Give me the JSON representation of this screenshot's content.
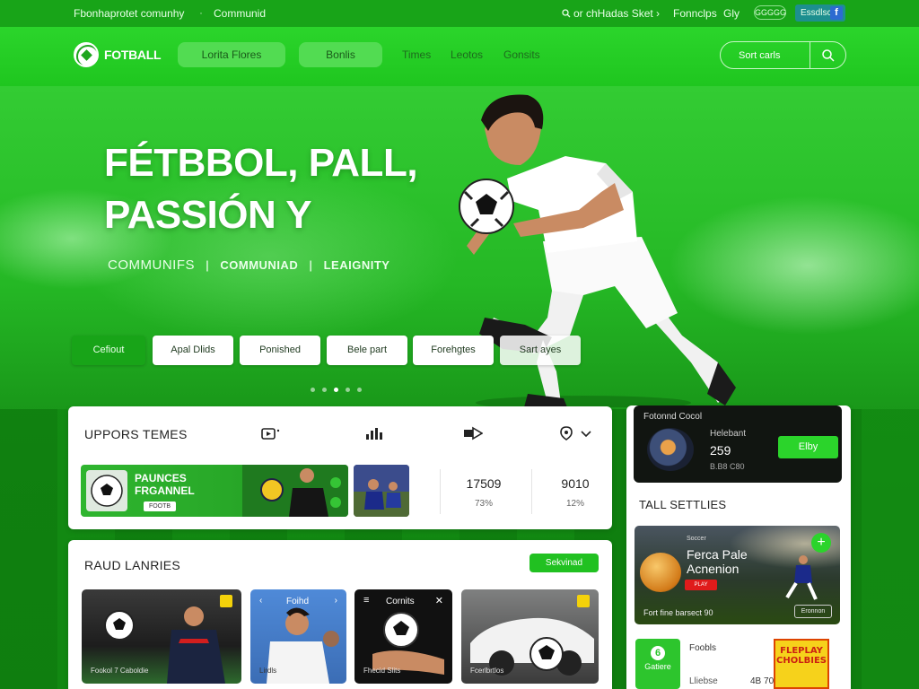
{
  "topbar": {
    "left_text": "Fbonhaprotet comunhy",
    "separator": "·",
    "left_link": "Communid",
    "right_link_1": "or chHadas Sket",
    "right_link_2": "Fonnclps",
    "right_link_3": "Gly",
    "pill": "GGGGG",
    "button": "Essdlscra",
    "facebook_glyph": "f"
  },
  "nav": {
    "logo_text": "FOTBALL",
    "pill_1": "Lorita Flores",
    "pill_2": "Bonlis",
    "link_1": "Times",
    "link_2": "Leotos",
    "link_3": "Gonsits",
    "search_placeholder": "Sort carls"
  },
  "hero": {
    "headline_line_1": "FÉTBBOL, PALL,",
    "headline_line_2": "PASSIÓN Y",
    "sub_1": "COMMUNIFS",
    "sub_sep": "|",
    "sub_2": "COMMUNIAD",
    "sub_3": "LEAIGNITY",
    "chips": [
      "Cefiout",
      "Apal Dlids",
      "Ponished",
      "Bele part",
      "Forehgtes",
      "Sart ayes"
    ],
    "active_chip": 0,
    "carousel_dots": 5,
    "active_dot": 2
  },
  "upcoming": {
    "title": "UPPORS TEMES",
    "feature_title_1": "PAUNCES",
    "feature_title_2": "FRGANNEL",
    "feature_badge": "FOOTB",
    "stat_1_value": "17509",
    "stat_1_pct": "73%",
    "stat_2_value": "9010",
    "stat_2_pct": "12%"
  },
  "leagues": {
    "title": "RAUD LANRIES",
    "select_label": "Sekvinad",
    "cards": [
      {
        "label": "Fookol 7 Caboldie"
      },
      {
        "label": "Lirdls",
        "header": "Foihd"
      },
      {
        "label": "Fhecid Slits",
        "header": "Cornits"
      },
      {
        "label": "Fcerlbrtlos"
      }
    ]
  },
  "profile_card": {
    "title": "Fotonnd Cocol",
    "name_label": "Helebant",
    "value": "259",
    "sub_value": "B.B8 C80",
    "button": "Elby"
  },
  "side": {
    "title": "TALL SETTLIES",
    "promo_label": "Soccer",
    "promo_title_1": "Ferca Pale",
    "promo_title_2": "Acnenion",
    "promo_badge": "PLAY",
    "promo_bottom": "Fort fine barsect 90",
    "promo_button": "Eronnon",
    "plus": "+",
    "mini_label": "Gatiere",
    "mini_icon": "6",
    "misc_1": "Foobls",
    "misc_2": "Lliebse",
    "misc_3": "4B 70",
    "comic_1": "FLEPLAY",
    "comic_2": "CHOLBIES"
  },
  "colors": {
    "primary_green": "#20c020",
    "dark_green": "#18a418",
    "panel_white": "#ffffff",
    "accent_yellow": "#f4d20a"
  }
}
